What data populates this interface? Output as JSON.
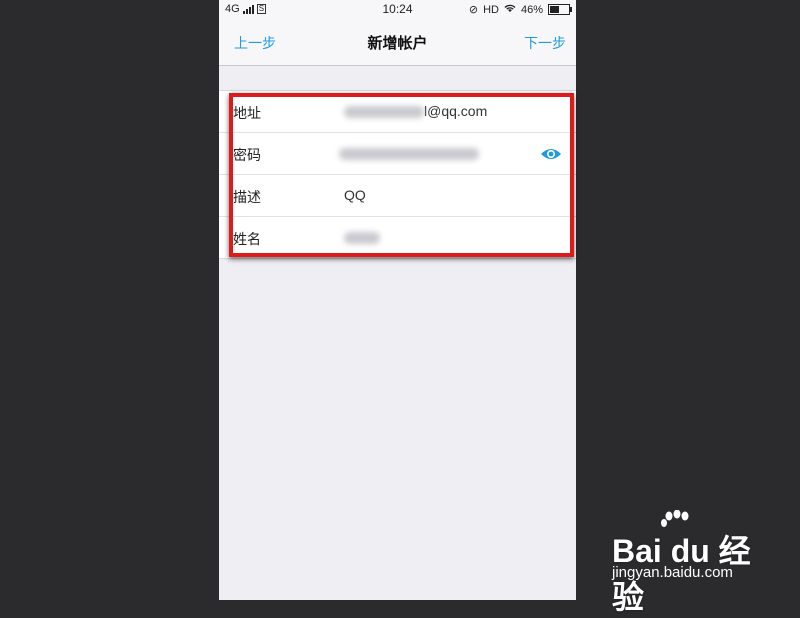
{
  "statusbar": {
    "network": "4G",
    "time": "10:24",
    "hd": "HD",
    "battery": "46%"
  },
  "nav": {
    "back_label": "上一步",
    "title": "新增帐户",
    "next_label": "下一步"
  },
  "form": {
    "rows": [
      {
        "label": "地址",
        "value": "l@qq.com"
      },
      {
        "label": "密码",
        "value": ""
      },
      {
        "label": "描述",
        "value": "QQ"
      },
      {
        "label": "姓名",
        "value": ""
      }
    ]
  },
  "watermark": {
    "main": "Bai du 经验",
    "sub": "jingyan.baidu.com"
  },
  "colors": {
    "accent": "#1f9bde",
    "highlight": "#dd1b1b"
  }
}
